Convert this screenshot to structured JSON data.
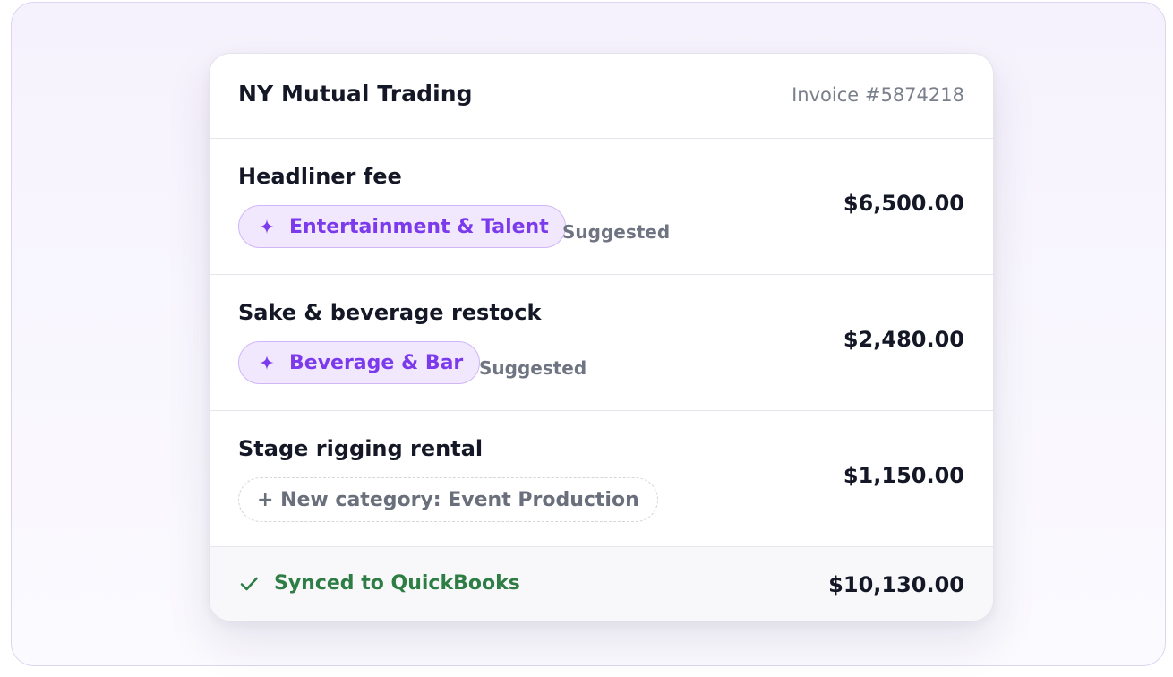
{
  "invoice_card": {
    "vendor": "NY Mutual Trading",
    "invoice_number": "Invoice #5874218"
  },
  "line_items": [
    {
      "title": "Headliner fee",
      "category": "Entertainment & Talent",
      "status": "Suggested",
      "amount": "$6,500.00"
    },
    {
      "title": "Sake & beverage restock",
      "category": "Beverage & Bar",
      "status": "Suggested",
      "amount": "$2,480.00"
    },
    {
      "title": "Stage rigging rental",
      "new_category": "+ New category: Event Production",
      "amount": "$1,150.00"
    }
  ],
  "footer": {
    "sync_status": "Synced to QuickBooks",
    "total": "$10,130.00"
  },
  "colors": {
    "accent_purple": "#7c3aed",
    "chip_bg": "#f1e8fd",
    "chip_border": "#cfb6f6",
    "success_green": "#2e7d45"
  },
  "icons": {
    "chip_icon": "sparkle-icon",
    "sync_icon": "check-icon"
  }
}
